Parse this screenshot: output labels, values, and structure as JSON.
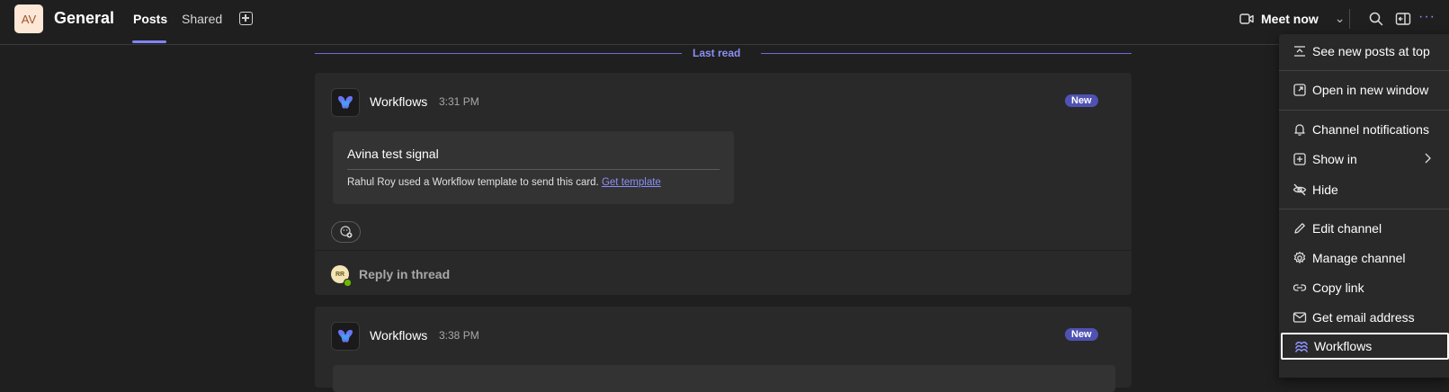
{
  "header": {
    "team_avatar_initials": "AV",
    "channel_title": "General",
    "tabs": [
      {
        "label": "Posts",
        "active": true
      },
      {
        "label": "Shared",
        "active": false
      }
    ],
    "meet_now_label": "Meet now"
  },
  "feed": {
    "last_read_label": "Last read",
    "posts": [
      {
        "sender": "Workflows",
        "time": "3:31 PM",
        "badge": "New",
        "card": {
          "title": "Avina test signal",
          "description": "Rahul Roy used a Workflow template to send this card.",
          "link_text": "Get template"
        },
        "reply": {
          "avatar_initials": "RR",
          "label": "Reply in thread"
        }
      },
      {
        "sender": "Workflows",
        "time": "3:38 PM",
        "badge": "New"
      }
    ]
  },
  "menu": {
    "items": [
      {
        "label": "See new posts at top",
        "icon": "posts-top-icon"
      },
      {
        "label": "Open in new window",
        "icon": "open-window-icon"
      },
      {
        "label": "Channel notifications",
        "icon": "bell-icon"
      },
      {
        "label": "Show in",
        "icon": "show-in-icon",
        "has_submenu": true
      },
      {
        "label": "Hide",
        "icon": "eye-off-icon"
      },
      {
        "label": "Edit channel",
        "icon": "pencil-icon"
      },
      {
        "label": "Manage channel",
        "icon": "gear-icon"
      },
      {
        "label": "Copy link",
        "icon": "link-icon"
      },
      {
        "label": "Get email address",
        "icon": "mail-icon"
      },
      {
        "label": "Workflows",
        "icon": "workflows-icon",
        "selected": true
      }
    ]
  },
  "colors": {
    "accent": "#7f85f5",
    "badge": "#4f52b2",
    "background": "#1f1f1f",
    "surface": "#292929"
  }
}
